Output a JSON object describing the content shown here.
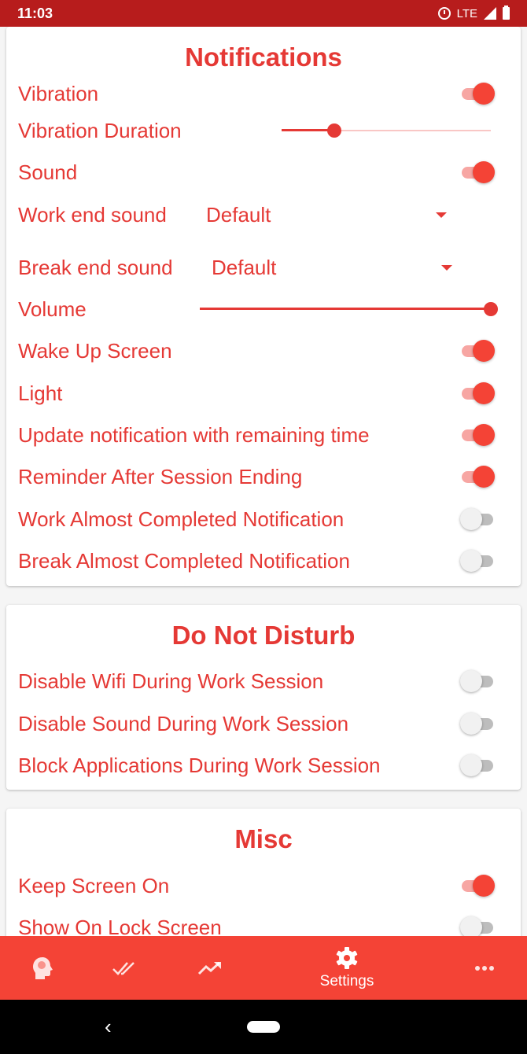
{
  "status": {
    "time": "11:03",
    "network": "LTE"
  },
  "notifications": {
    "title": "Notifications",
    "vibration": {
      "label": "Vibration",
      "on": true
    },
    "vibration_duration": {
      "label": "Vibration Duration",
      "value": 0.25
    },
    "sound": {
      "label": "Sound",
      "on": true
    },
    "work_end_sound": {
      "label": "Work end sound",
      "value": "Default"
    },
    "break_end_sound": {
      "label": "Break end sound",
      "value": "Default"
    },
    "volume": {
      "label": "Volume",
      "value": 1.0
    },
    "wake_up_screen": {
      "label": "Wake Up Screen",
      "on": true
    },
    "light": {
      "label": "Light",
      "on": true
    },
    "update_notification": {
      "label": "Update notification with remaining time",
      "on": true
    },
    "reminder": {
      "label": "Reminder After Session Ending",
      "on": true
    },
    "work_almost": {
      "label": "Work Almost Completed Notification",
      "on": false
    },
    "break_almost": {
      "label": "Break Almost Completed Notification",
      "on": false
    }
  },
  "dnd": {
    "title": "Do Not Disturb",
    "disable_wifi": {
      "label": "Disable Wifi During Work Session",
      "on": false
    },
    "disable_sound": {
      "label": "Disable Sound During Work Session",
      "on": false
    },
    "block_apps": {
      "label": "Block Applications During Work Session",
      "on": false
    }
  },
  "misc": {
    "title": "Misc",
    "keep_screen_on": {
      "label": "Keep Screen On",
      "on": true
    },
    "show_on_lock": {
      "label": "Show On Lock Screen",
      "on": false
    }
  },
  "bottom_nav": {
    "items": [
      {
        "icon": "brain-head-icon",
        "label": ""
      },
      {
        "icon": "double-check-icon",
        "label": ""
      },
      {
        "icon": "trending-up-icon",
        "label": ""
      },
      {
        "icon": "gear-icon",
        "label": "Settings",
        "selected": true
      },
      {
        "icon": "more-horizontal-icon",
        "label": ""
      }
    ]
  },
  "colors": {
    "accent": "#e53935",
    "nav": "#f44336",
    "status_bar": "#b71c1c"
  }
}
